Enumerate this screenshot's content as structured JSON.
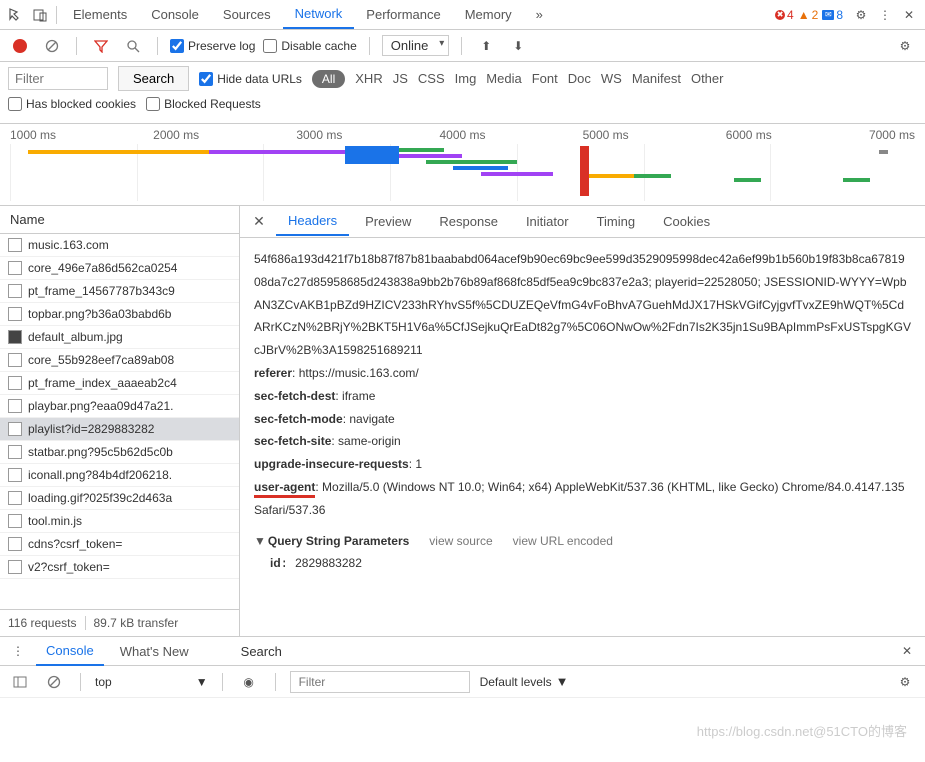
{
  "topTabs": {
    "items": [
      "Elements",
      "Console",
      "Sources",
      "Network",
      "Performance",
      "Memory"
    ],
    "more": "»",
    "errors": "4",
    "warnings": "2",
    "infos": "8"
  },
  "toolbar": {
    "preserve": "Preserve log",
    "disable": "Disable cache",
    "throttle": "Online"
  },
  "filter": {
    "placeholder": "Filter",
    "search": "Search",
    "hideUrls": "Hide data URLs",
    "all": "All",
    "types": [
      "XHR",
      "JS",
      "CSS",
      "Img",
      "Media",
      "Font",
      "Doc",
      "WS",
      "Manifest",
      "Other"
    ],
    "blockedCookies": "Has blocked cookies",
    "blockedReq": "Blocked Requests"
  },
  "waterfall": {
    "ticks": [
      "1000 ms",
      "2000 ms",
      "3000 ms",
      "4000 ms",
      "5000 ms",
      "6000 ms",
      "7000 ms"
    ]
  },
  "nameCol": {
    "header": "Name",
    "items": [
      {
        "label": "music.163.com"
      },
      {
        "label": "core_496e7a86d562ca0254"
      },
      {
        "label": "pt_frame_14567787b343c9"
      },
      {
        "label": "topbar.png?b36a03babd6b"
      },
      {
        "label": "default_album.jpg",
        "img": true
      },
      {
        "label": "core_55b928eef7ca89ab08"
      },
      {
        "label": "pt_frame_index_aaaeab2c4"
      },
      {
        "label": "playbar.png?eaa09d47a21."
      },
      {
        "label": "playlist?id=2829883282",
        "sel": true
      },
      {
        "label": "statbar.png?95c5b62d5c0b"
      },
      {
        "label": "iconall.png?84b4df206218."
      },
      {
        "label": "loading.gif?025f39c2d463a"
      },
      {
        "label": "tool.min.js"
      },
      {
        "label": "cdns?csrf_token="
      },
      {
        "label": "v2?csrf_token="
      }
    ],
    "footer": {
      "req": "116 requests",
      "size": "89.7 kB transfer"
    }
  },
  "detail": {
    "tabs": [
      "Headers",
      "Preview",
      "Response",
      "Initiator",
      "Timing",
      "Cookies"
    ],
    "cookieBlob": "54f686a193d421f7b18b87f87b81baababd064acef9b90ec69bc9ee599d3529095998dec42a6ef99b1b560b19f83b8ca6781908da7c27d85958685d243838a9bb2b76b89af868fc85df5ea9c9bc837e2a3; playerid=22528050; JSESSIONID-WYYY=WpbAN3ZCvAKB1pBZd9HZICV233hRYhvS5f%5CDUZEQeVfmG4vFoBhvA7GuehMdJX17HSkVGifCyjgvfTvxZE9hWQT%5CdARrKCzN%2BRjY%2BKT5H1V6a%5CfJSejkuQrEaDt82g7%5C06ONwOw%2Fdn7Is2K35jn1Su9BApImmPsFxUSTspgKGVcJBrV%2B%3A1598251689211",
    "headers": [
      {
        "k": "referer",
        "v": "https://music.163.com/"
      },
      {
        "k": "sec-fetch-dest",
        "v": "iframe"
      },
      {
        "k": "sec-fetch-mode",
        "v": "navigate"
      },
      {
        "k": "sec-fetch-site",
        "v": "same-origin"
      },
      {
        "k": "upgrade-insecure-requests",
        "v": "1"
      }
    ],
    "uaKey": "user-agent",
    "uaVal": "Mozilla/5.0 (Windows NT 10.0; Win64; x64) AppleWebKit/537.36 (KHTML, like Gecko) Chrome/84.0.4147.135 Safari/537.36",
    "qsp": {
      "title": "Query String Parameters",
      "viewSource": "view source",
      "viewEnc": "view URL encoded",
      "id_k": "id",
      "id_v": "2829883282"
    }
  },
  "drawer": {
    "tabs": [
      "Console",
      "What's New"
    ],
    "search": "Search",
    "top": "top",
    "filterPh": "Filter",
    "levels": "Default levels"
  },
  "watermark": "https://blog.csdn.net@51CTO的博客"
}
